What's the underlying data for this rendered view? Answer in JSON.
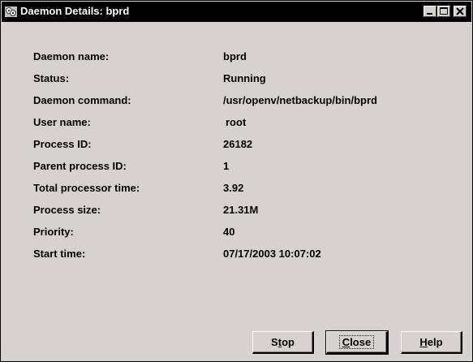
{
  "window": {
    "title": "Daemon Details: bprd",
    "icon": "daemon-app-icon"
  },
  "titlebar_controls": {
    "minimize_icon": "minimize-icon",
    "maximize_icon": "maximize-icon",
    "close_icon": "close-icon"
  },
  "details": [
    {
      "label": "Daemon name:",
      "value": "bprd"
    },
    {
      "label": "Status:",
      "value": "Running"
    },
    {
      "label": "Daemon command:",
      "value": "/usr/openv/netbackup/bin/bprd"
    },
    {
      "label": "User name:",
      "value": "root"
    },
    {
      "label": "Process ID:",
      "value": "26182"
    },
    {
      "label": "Parent process ID:",
      "value": "1"
    },
    {
      "label": "Total processor time:",
      "value": "3.92"
    },
    {
      "label": "Process size:",
      "value": "21.31M"
    },
    {
      "label": "Priority:",
      "value": "40"
    },
    {
      "label": "Start time:",
      "value": "07/17/2003 10:07:02"
    }
  ],
  "buttons": {
    "stop": {
      "pre": "S",
      "mnemonic": "t",
      "post": "op"
    },
    "close": {
      "pre": "",
      "mnemonic": "C",
      "post": "lose"
    },
    "help": {
      "pre": "",
      "mnemonic": "H",
      "post": "elp"
    }
  },
  "colors": {
    "titlebar": "#000000",
    "window_bg": "#d6d3ce",
    "text": "#000000"
  }
}
